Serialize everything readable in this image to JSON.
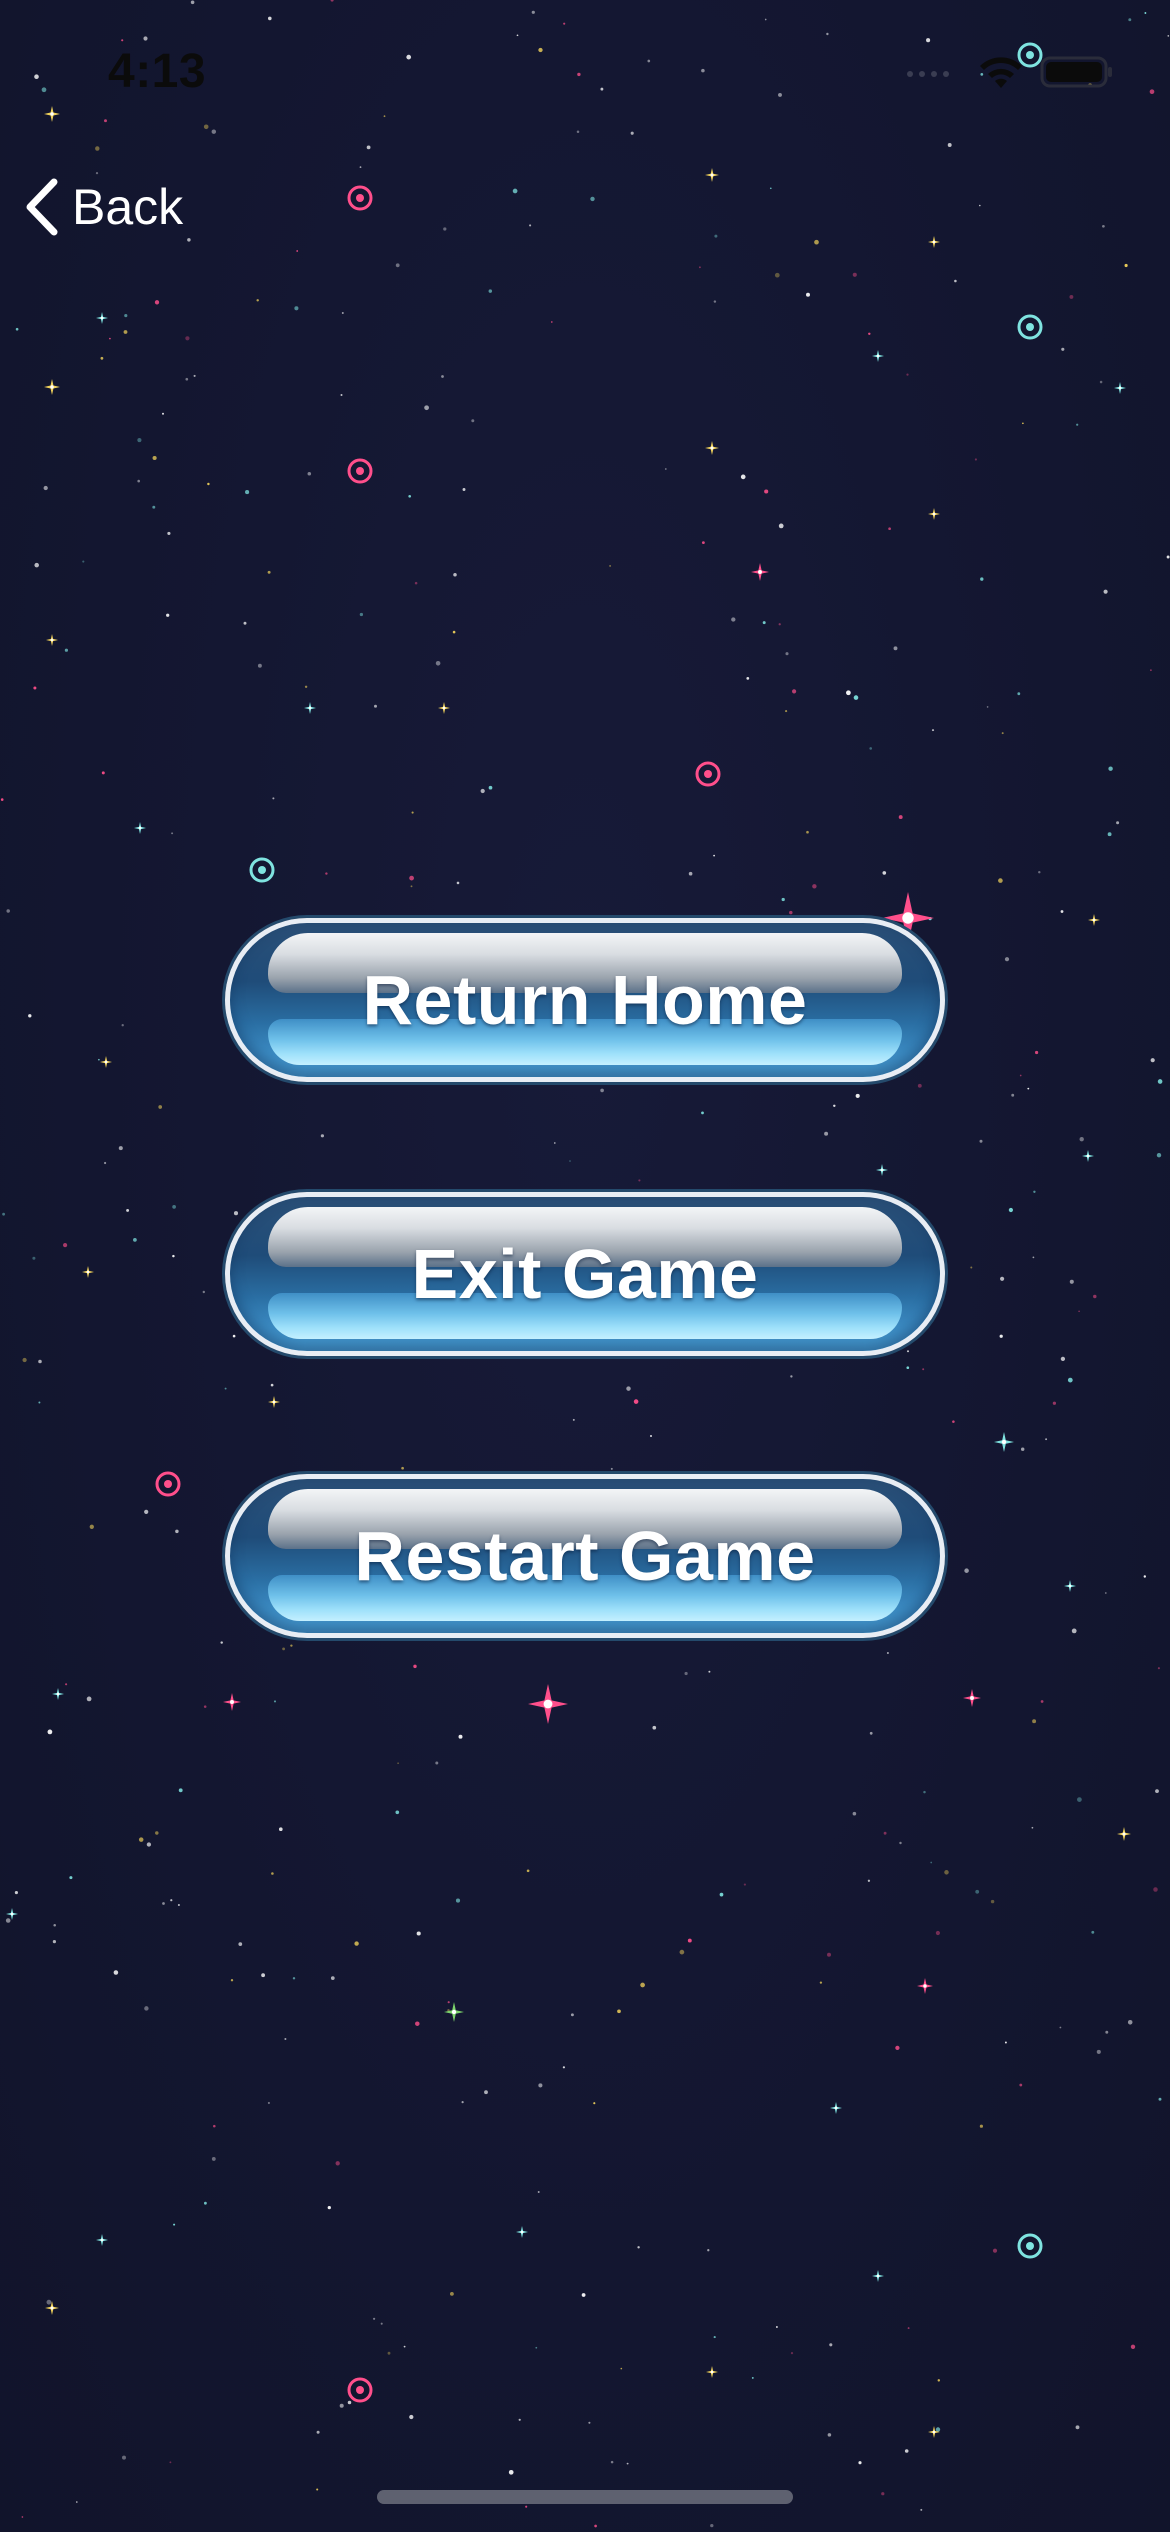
{
  "status_bar": {
    "time": "4:13"
  },
  "nav": {
    "back_label": "Back"
  },
  "menu": {
    "buttons": [
      {
        "label": "Return Home"
      },
      {
        "label": "Exit Game"
      },
      {
        "label": "Restart Game"
      }
    ]
  },
  "colors": {
    "background": "#131630",
    "button_fill": "#2a6ea3",
    "button_border": "#e8edf4",
    "star_pink": "#ff4f8b",
    "star_cyan": "#7fe3e0",
    "star_yellow": "#f2d35b",
    "star_white": "#ffffff",
    "star_green": "#7bd36b"
  },
  "icons": {
    "back": "chevron-left-icon",
    "signal": "cellular-signal-icon",
    "wifi": "wifi-icon",
    "battery": "battery-icon"
  }
}
